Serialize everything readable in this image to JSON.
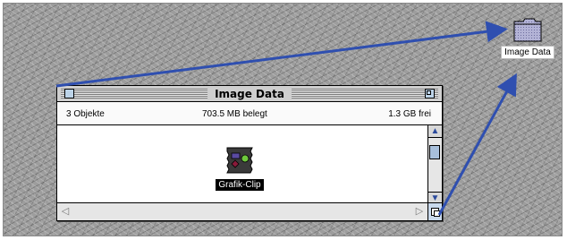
{
  "desktop": {
    "folder_label": "Image Data"
  },
  "window": {
    "title": "Image Data",
    "info": {
      "items": "3 Objekte",
      "used": "703.5 MB belegt",
      "free": "1.3 GB frei"
    },
    "file": {
      "label": "Grafik-Clip"
    }
  },
  "colors": {
    "arrow": "#2f4fb0",
    "folder": "#b3b3d6",
    "desktop": "#9d9d9d"
  }
}
